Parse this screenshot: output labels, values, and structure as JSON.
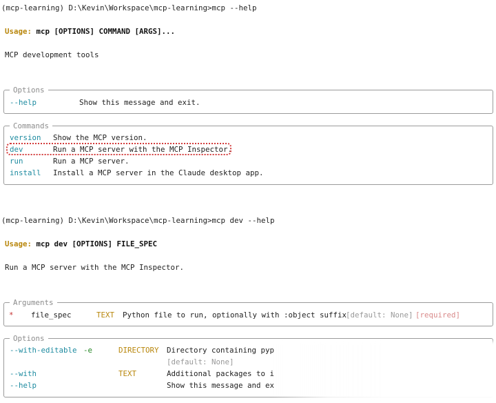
{
  "first": {
    "prompt": "(mcp-learning) D:\\Kevin\\Workspace\\mcp-learning>mcp --help",
    "usage_key": "Usage:",
    "usage_rest": " mcp [OPTIONS] COMMAND [ARGS]...",
    "description": "MCP development tools",
    "options_title": "Options",
    "options": [
      {
        "flag": "--help",
        "desc": "Show this message and exit."
      }
    ],
    "commands_title": "Commands",
    "commands": [
      {
        "name": "version",
        "desc": "Show the MCP version."
      },
      {
        "name": "dev",
        "desc": "Run a MCP server with the MCP Inspector."
      },
      {
        "name": "run",
        "desc": "Run a MCP server."
      },
      {
        "name": "install",
        "desc": "Install a MCP server in the Claude desktop app."
      }
    ]
  },
  "second": {
    "prompt": "(mcp-learning) D:\\Kevin\\Workspace\\mcp-learning>mcp dev --help",
    "usage_key": "Usage:",
    "usage_rest": " mcp dev [OPTIONS] FILE_SPEC",
    "description": "Run a MCP server with the MCP Inspector.",
    "arguments_title": "Arguments",
    "argument": {
      "marker": "*",
      "name": "file_spec",
      "type": "TEXT",
      "desc": "Python file to run, optionally with :object suffix",
      "default": "[default: None]",
      "required": "[required]"
    },
    "options_title": "Options",
    "options": [
      {
        "flag": "--with-editable",
        "short": "-e",
        "type": "DIRECTORY",
        "desc": "Directory containing pyp",
        "default": "[default: None]"
      },
      {
        "flag": "--with",
        "type": "TEXT",
        "desc": "Additional packages to i"
      },
      {
        "flag": "--help",
        "desc": "Show this message and ex"
      }
    ]
  }
}
